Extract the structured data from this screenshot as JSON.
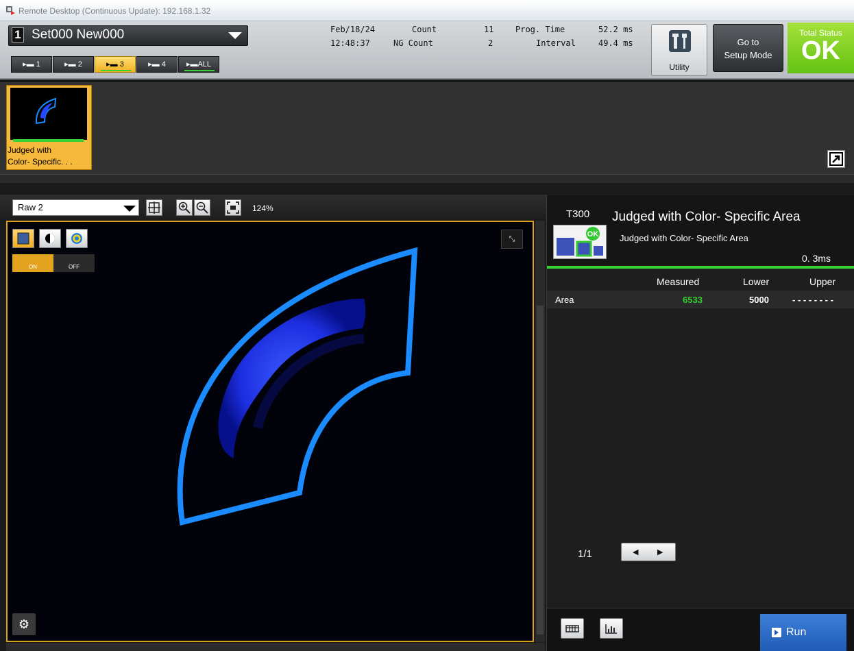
{
  "window": {
    "title": "Remote Desktop (Continuous Update): 192.168.1.32"
  },
  "header": {
    "set_number": "1",
    "set_name": "Set000  New000",
    "date": "Feb/18/24",
    "time": "12:48:37",
    "count_label": "Count",
    "count_value": "11",
    "ng_count_label": "NG Count",
    "ng_count_value": "2",
    "prog_time_label": "Prog. Time",
    "prog_time_value": "52.2 ms",
    "interval_label": "Interval",
    "interval_value": "49.4 ms",
    "camera_tabs": [
      {
        "label": "1"
      },
      {
        "label": "2"
      },
      {
        "label": "3"
      },
      {
        "label": "4"
      },
      {
        "label": "ALL"
      }
    ],
    "active_camera_tab": "3",
    "utility_label": "Utility",
    "go_setup_line1": "Go to",
    "go_setup_line2": "Setup Mode",
    "total_status_label": "Total Status",
    "total_status_value": "OK"
  },
  "thumbnails": [
    {
      "line1": "Judged with",
      "line2": "Color- Specific. . ."
    }
  ],
  "view_toolbar": {
    "image_source": "Raw  2",
    "zoom": "124%"
  },
  "image_overlay": {
    "on_label": "ON",
    "off_label": "OFF"
  },
  "tool": {
    "code": "T300",
    "name": "Judged with  Color- Specific  Area",
    "description": "Judged with  Color- Specific  Area",
    "time": "0. 3ms",
    "status_badge": "OK",
    "columns": [
      "Measured",
      "Lower",
      "Upper"
    ],
    "rows": [
      {
        "name": "Area",
        "measured": "6533",
        "lower": "5000",
        "upper": "- - - - - - - -"
      }
    ],
    "page": "1/1",
    "run_label": "Run"
  },
  "colors": {
    "ok_green": "#64c212",
    "measured_green": "#2fd12f",
    "active_tab": "#f0b020",
    "run_blue": "#1f5cb7"
  }
}
